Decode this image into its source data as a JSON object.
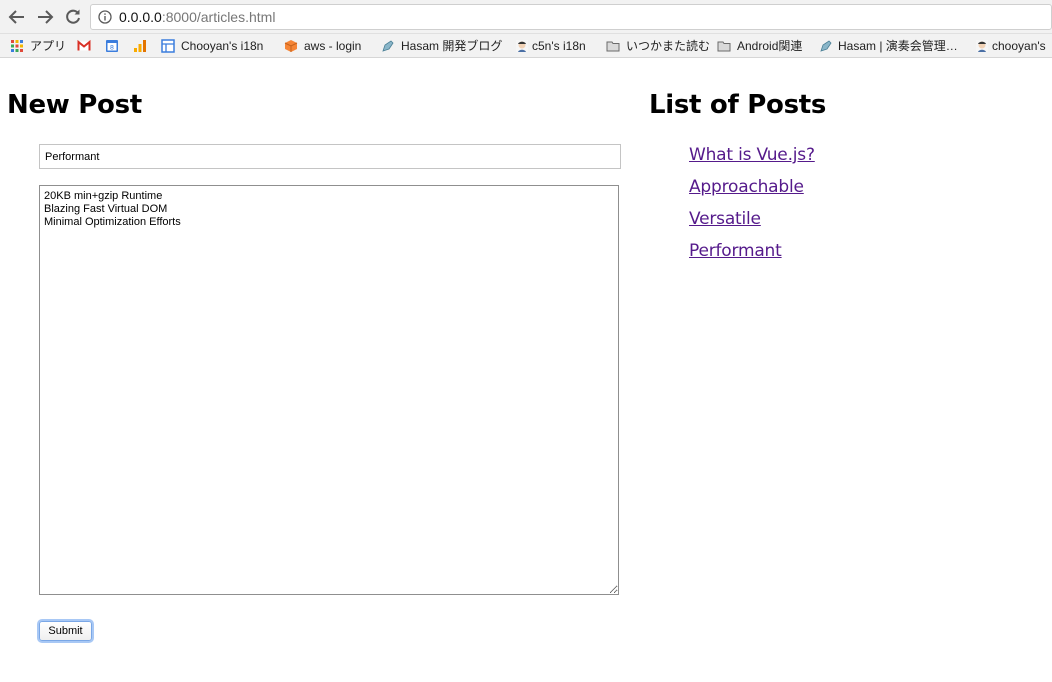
{
  "browser": {
    "url_host": "0.0.0.0",
    "url_rest": ":8000/articles.html",
    "bookmarks": [
      {
        "label": "アプリ",
        "icon": "apps-grid-icon"
      },
      {
        "label": "",
        "icon": "gmail-icon"
      },
      {
        "label": "",
        "icon": "calendar-icon"
      },
      {
        "label": "",
        "icon": "analytics-icon"
      },
      {
        "label": "Chooyan's i18n",
        "icon": "sheet-icon"
      },
      {
        "label": "aws - login",
        "icon": "aws-cube-icon"
      },
      {
        "label": "Hasam 開発ブログ",
        "icon": "blog-icon"
      },
      {
        "label": "c5n's i18n",
        "icon": "avatar-icon"
      },
      {
        "label": "いつかまた読む",
        "icon": "folder-icon"
      },
      {
        "label": "Android関連",
        "icon": "folder-icon"
      },
      {
        "label": "Hasam | 演奏会管理…",
        "icon": "blog-icon"
      },
      {
        "label": "chooyan's",
        "icon": "avatar-icon"
      }
    ]
  },
  "new_post": {
    "heading": "New Post",
    "title_value": "Performant",
    "body_value": "20KB min+gzip Runtime\nBlazing Fast Virtual DOM\nMinimal Optimization Efforts",
    "submit_label": "Submit"
  },
  "post_list": {
    "heading": "List of Posts",
    "posts": [
      {
        "title": "What is Vue.js?"
      },
      {
        "title": "Approachable"
      },
      {
        "title": "Versatile"
      },
      {
        "title": "Performant"
      }
    ]
  },
  "colors": {
    "visited_link": "#551a8b",
    "focus_ring": "#a8c8f5"
  }
}
